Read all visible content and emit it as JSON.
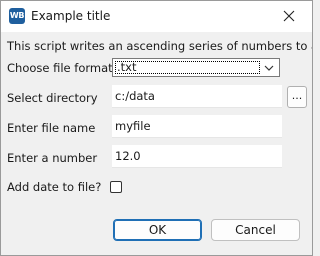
{
  "window": {
    "title": "Example title",
    "app_icon_text": "WB",
    "description": "This script writes an ascending series of numbers to a file."
  },
  "form": {
    "file_format": {
      "label": "Choose file format",
      "value": ".txt"
    },
    "directory": {
      "label": "Select directory",
      "value": "c:/data",
      "browse_label": "..."
    },
    "file_name": {
      "label": "Enter file name",
      "value": "myfile"
    },
    "number": {
      "label": "Enter a number",
      "value": "12.0"
    },
    "add_date": {
      "label": "Add date to file?",
      "checked": false
    }
  },
  "buttons": {
    "ok": "OK",
    "cancel": "Cancel"
  },
  "colors": {
    "accent": "#1f6fb5",
    "icon_bg": "#1f5f9e"
  }
}
